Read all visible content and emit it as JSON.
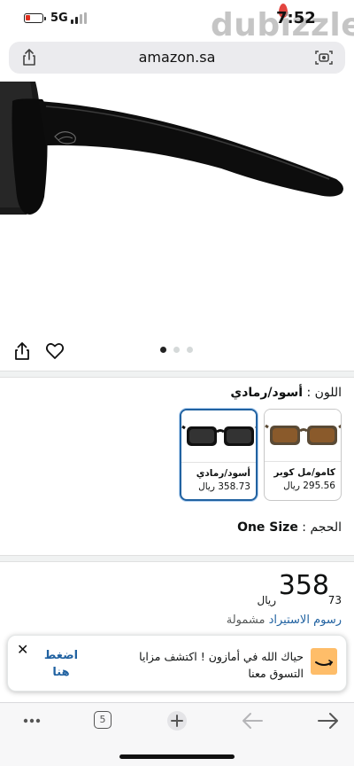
{
  "status_bar": {
    "network": "5G",
    "time": "7:52",
    "watermark": "dubizzle"
  },
  "browser": {
    "url": "amazon.sa",
    "tab_count": "5"
  },
  "gallery": {
    "page_count": 3,
    "active_page": 1
  },
  "product": {
    "color_label": "اللون :",
    "color_value": "أسود/رمادي",
    "variants": [
      {
        "name": "أسود/رمادي",
        "price": "358.73 ريال",
        "selected": true
      },
      {
        "name": "كامو/مل كوبر",
        "price": "295.56 ريال",
        "selected": false
      }
    ],
    "size_label": "الحجم :",
    "size_value": "One Size",
    "price_whole": "358",
    "price_cents": "73",
    "currency": "ريال",
    "import_fees_link": "رسوم الاستيراد",
    "import_fees_note": "مشمولة"
  },
  "toast": {
    "message": "حياك الله في أمازون ! اكتشف مزايا التسوق معنا",
    "cta": "اضغط هنا"
  },
  "colors": {
    "accent_blue": "#2162a1",
    "amazon_orange": "#febd69"
  }
}
